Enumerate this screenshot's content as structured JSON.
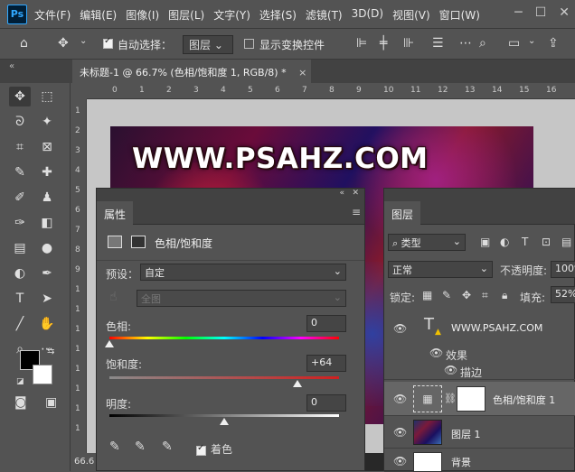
{
  "app": {
    "logo": "Ps"
  },
  "menubar": {
    "items": [
      "文件(F)",
      "编辑(E)",
      "图像(I)",
      "图层(L)",
      "文字(Y)",
      "选择(S)",
      "滤镜(T)",
      "3D(D)",
      "视图(V)",
      "窗口(W)"
    ]
  },
  "window_controls": {
    "minimize": "─",
    "maximize": "☐",
    "close": "✕"
  },
  "options": {
    "auto_select_label": "自动选择：",
    "auto_select_value": "图层",
    "show_transform_label": "显示变换控件"
  },
  "document_tab": {
    "title": "未标题-1 @ 66.7% (色相/饱和度 1, RGB/8) *",
    "close": "×"
  },
  "ruler": {
    "top_ticks": [
      "0",
      "1",
      "2",
      "3",
      "4",
      "5",
      "6",
      "7",
      "8",
      "9",
      "10",
      "11",
      "12",
      "13",
      "14",
      "15",
      "16"
    ],
    "left_ticks": [
      "1",
      "2",
      "3",
      "4",
      "5",
      "6",
      "7",
      "8",
      "9",
      "1",
      "1",
      "1",
      "1",
      "1",
      "1",
      "1",
      "1"
    ]
  },
  "canvas": {
    "watermark_text": "WWW.PSAHZ.COM"
  },
  "status": {
    "zoom": "66.6"
  },
  "properties": {
    "tab": "属性",
    "adjust_title": "色相/饱和度",
    "preset_label": "预设：",
    "preset_value": "自定",
    "channel_value": "全图",
    "hue_label": "色相:",
    "hue_value": "0",
    "saturation_label": "饱和度:",
    "saturation_value": "+64",
    "lightness_label": "明度:",
    "lightness_value": "0",
    "colorize_label": "着色",
    "colorize_checked": true,
    "hue_position": 0.0,
    "saturation_position": 0.64,
    "lightness_position": 0.0
  },
  "layers": {
    "tab": "图层",
    "filter_value": "类型",
    "blend_mode": "正常",
    "opacity_label": "不透明度:",
    "opacity_value": "100%",
    "lock_label": "锁定:",
    "fill_label": "填充:",
    "fill_value": "52%",
    "items": [
      {
        "name": "WWW.PSAHZ.COM",
        "kind": "text"
      },
      {
        "name": "效果",
        "kind": "effects"
      },
      {
        "name": "描边",
        "kind": "effect"
      },
      {
        "name": "色相/饱和度 1",
        "kind": "adjustment"
      },
      {
        "name": "图层 1",
        "kind": "pixel"
      },
      {
        "name": "背景",
        "kind": "background"
      }
    ]
  },
  "colors": {
    "accent": "#31a8ff",
    "panel": "#535353",
    "dark": "#424242"
  }
}
